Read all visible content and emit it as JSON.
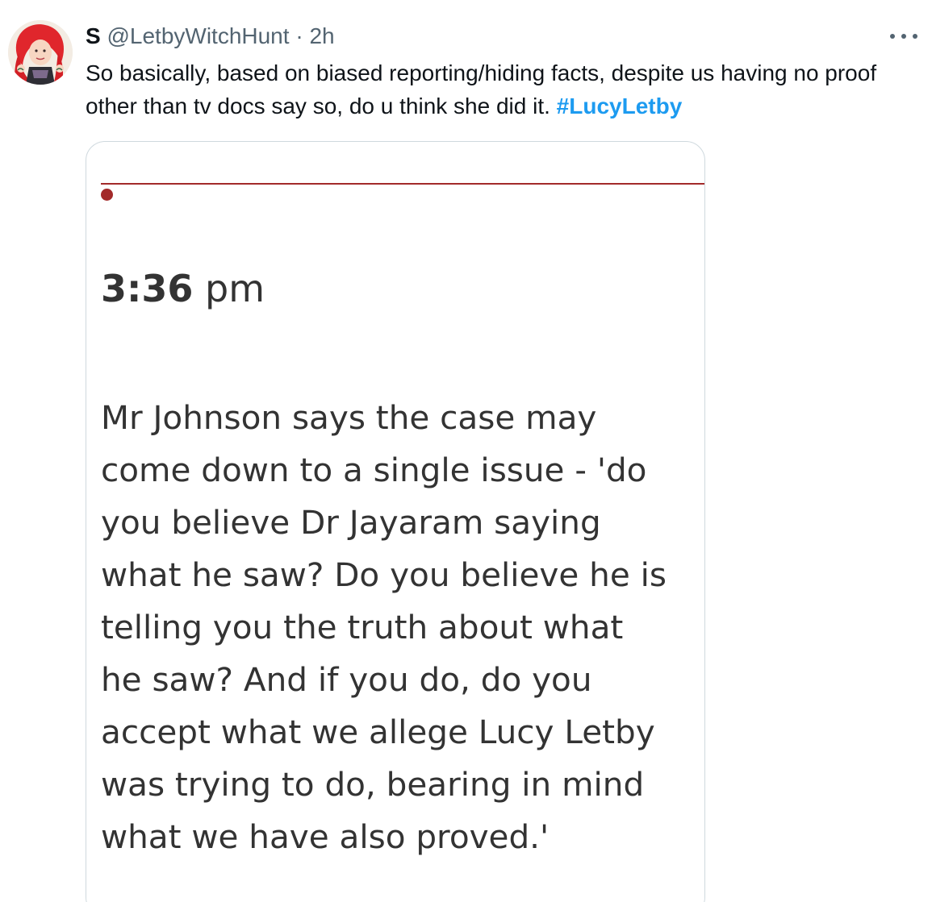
{
  "tweet": {
    "display_name": "S",
    "handle": "@LetbyWitchHunt",
    "separator": "·",
    "timestamp": "2h",
    "more_icon": "more-horizontal-icon",
    "text": "So basically, based on biased reporting/hiding facts, despite us having no proof other than tv docs say so, do u think she did it.",
    "hashtag": "#LucyLetby"
  },
  "media": {
    "time_bold": "3:36",
    "time_suffix": "pm",
    "body_lines": [
      "Mr Johnson says the case may",
      "come down to a single issue - 'do",
      "you believe Dr Jayaram saying",
      "what he saw? Do you believe he is",
      "telling you the truth about what",
      "he saw? And if you do, do you",
      "accept what we allege Lucy Letby",
      "was trying to do, bearing in mind",
      "what we have also proved.'"
    ]
  },
  "colors": {
    "hashtag": "#1d9bf0",
    "meta_text": "#536471",
    "accent_rule": "#a32a2a",
    "card_border": "#cfd9de"
  }
}
